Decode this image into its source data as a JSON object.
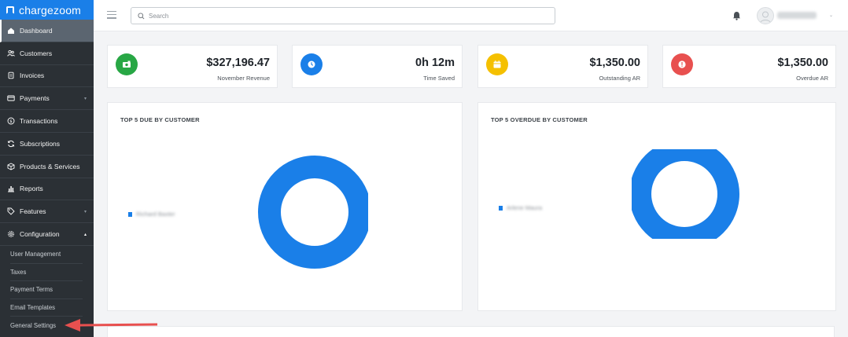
{
  "brand": {
    "name": "chargezoom",
    "color": "#1a7fe8"
  },
  "sidebar": {
    "items": [
      {
        "label": "Dashboard",
        "icon": "home-icon",
        "active": true
      },
      {
        "label": "Customers",
        "icon": "users-icon"
      },
      {
        "label": "Invoices",
        "icon": "invoice-icon"
      },
      {
        "label": "Payments",
        "icon": "card-icon",
        "caret": "▾"
      },
      {
        "label": "Transactions",
        "icon": "dollar-circle-icon"
      },
      {
        "label": "Subscriptions",
        "icon": "refresh-icon"
      },
      {
        "label": "Products & Services",
        "icon": "box-icon"
      },
      {
        "label": "Reports",
        "icon": "bar-chart-icon"
      },
      {
        "label": "Features",
        "icon": "tag-icon",
        "caret": "▾"
      },
      {
        "label": "Configuration",
        "icon": "gear-icon",
        "caret": "▴"
      }
    ],
    "config_subitems": [
      "User Management",
      "Taxes",
      "Payment Terms",
      "Email Templates",
      "General Settings"
    ]
  },
  "topbar": {
    "search_placeholder": "Search"
  },
  "stats": [
    {
      "value": "$327,196.47",
      "label": "November Revenue",
      "icon": "cash-icon",
      "color": "#28a745"
    },
    {
      "value": "0h 12m",
      "label": "Time Saved",
      "icon": "clock-icon",
      "color": "#1a7fe8"
    },
    {
      "value": "$1,350.00",
      "label": "Outstanding AR",
      "icon": "calendar-icon",
      "color": "#f5c000"
    },
    {
      "value": "$1,350.00",
      "label": "Overdue AR",
      "icon": "alert-icon",
      "color": "#e8504f"
    }
  ],
  "charts": [
    {
      "title": "TOP 5 DUE BY CUSTOMER",
      "slices": [
        {
          "value": 100,
          "color": "#1a7fe8"
        }
      ]
    },
    {
      "title": "TOP 5 OVERDUE BY CUSTOMER",
      "slices": [
        {
          "value": 100,
          "color": "#1a7fe8"
        }
      ]
    }
  ],
  "colors": {
    "annotation_arrow": "#e8504f"
  }
}
